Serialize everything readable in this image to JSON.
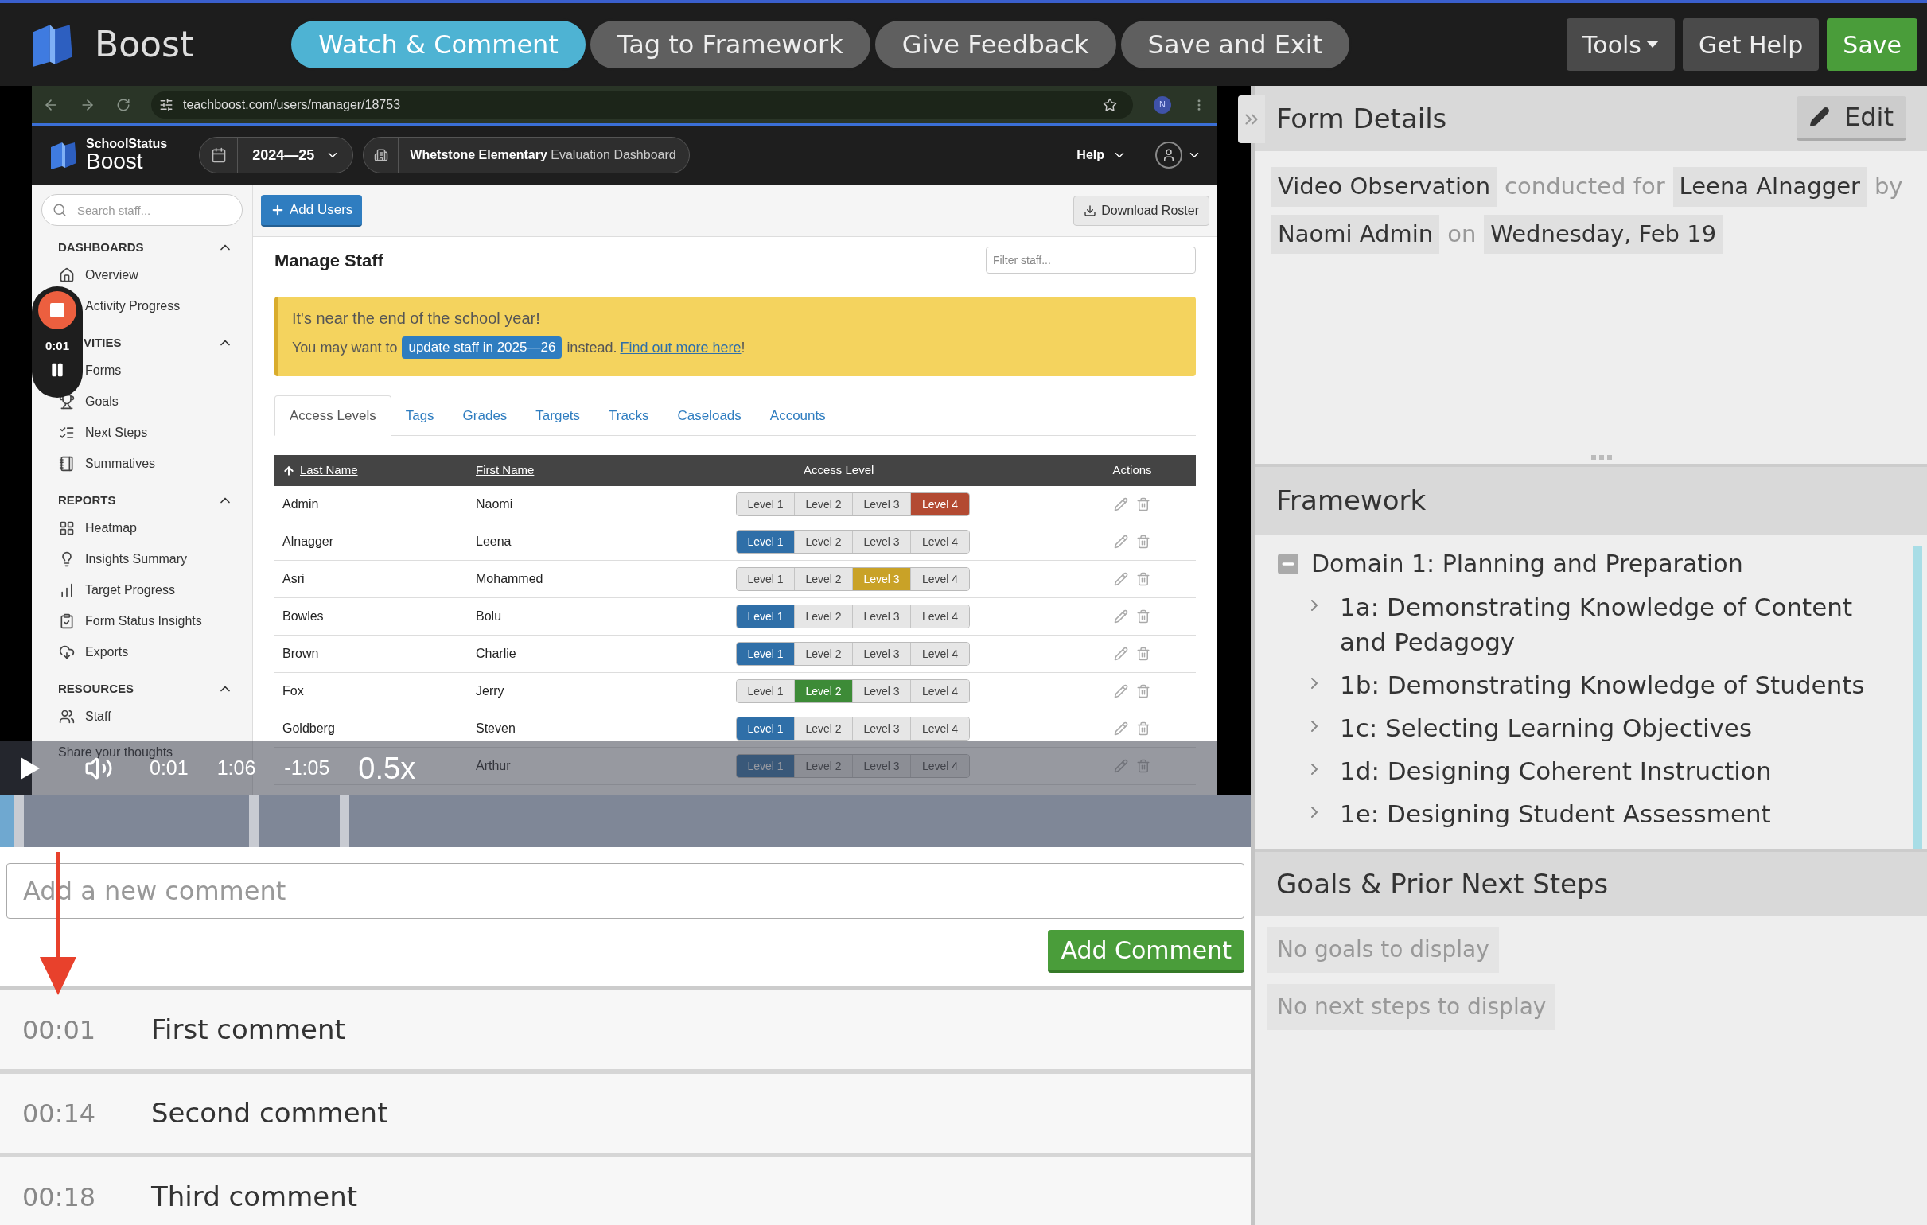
{
  "app_bar": {
    "logo_text": "Boost",
    "steps": [
      {
        "label": "Watch & Comment",
        "selected": true
      },
      {
        "label": "Tag to Framework",
        "selected": false
      },
      {
        "label": "Give Feedback",
        "selected": false
      },
      {
        "label": "Save and Exit",
        "selected": false
      }
    ],
    "buttons": [
      {
        "label": "Tools",
        "kind": "dropdown"
      },
      {
        "label": "Get Help",
        "kind": "plain"
      },
      {
        "label": "Save",
        "kind": "primary"
      }
    ]
  },
  "video": {
    "browser": {
      "url": "teachboost.com/users/manager/18753",
      "avatar": "N"
    },
    "app_header": {
      "brand_top": "SchoolStatus",
      "brand": "Boost",
      "year": "2024—25",
      "school": "Whetstone Elementary",
      "dashboard": "Evaluation Dashboard",
      "help": "Help"
    },
    "sidebar": {
      "search_placeholder": "Search staff...",
      "sections": [
        {
          "title": "DASHBOARDS",
          "expanded": true,
          "items": [
            "Overview",
            "Activity Progress"
          ]
        },
        {
          "title": "VITIES",
          "expanded": true,
          "items": [
            "Forms",
            "Goals",
            "Next Steps",
            "Summatives"
          ]
        },
        {
          "title": "REPORTS",
          "expanded": true,
          "items": [
            "Heatmap",
            "Insights Summary",
            "Target Progress",
            "Form Status Insights",
            "Exports"
          ]
        },
        {
          "title": "RESOURCES",
          "expanded": true,
          "items": [
            "Staff"
          ]
        }
      ],
      "footer": "Share your thoughts"
    },
    "toolbar": {
      "add_users": "Add Users",
      "download": "Download Roster"
    },
    "title": "Manage Staff",
    "filter_placeholder": "Filter staff...",
    "alert": {
      "heading": "It's near the end of the school year!",
      "before": "You may want to",
      "button": "update staff in 2025—26",
      "after": "instead.",
      "link": "Find out more here",
      "end": "!"
    },
    "tabs": [
      {
        "label": "Access Levels",
        "selected": true
      },
      {
        "label": "Tags",
        "selected": false
      },
      {
        "label": "Grades",
        "selected": false
      },
      {
        "label": "Targets",
        "selected": false
      },
      {
        "label": "Tracks",
        "selected": false
      },
      {
        "label": "Caseloads",
        "selected": false
      },
      {
        "label": "Accounts",
        "selected": false
      }
    ],
    "table": {
      "columns": [
        "Last Name",
        "First Name",
        "Access Level",
        "Actions"
      ],
      "rows": [
        {
          "last_name": "Admin",
          "first_name": "Naomi",
          "levels": [
            {
              "label": "Level 1",
              "selected": false
            },
            {
              "label": "Level 2",
              "selected": false
            },
            {
              "label": "Level 3",
              "selected": false
            },
            {
              "label": "Level 4",
              "selected": true
            }
          ]
        },
        {
          "last_name": "Alnagger",
          "first_name": "Leena",
          "levels": [
            {
              "label": "Level 1",
              "selected": true
            },
            {
              "label": "Level 2",
              "selected": false
            },
            {
              "label": "Level 3",
              "selected": false
            },
            {
              "label": "Level 4",
              "selected": false
            }
          ]
        },
        {
          "last_name": "Asri",
          "first_name": "Mohammed",
          "levels": [
            {
              "label": "Level 1",
              "selected": false
            },
            {
              "label": "Level 2",
              "selected": false
            },
            {
              "label": "Level 3",
              "selected": true
            },
            {
              "label": "Level 4",
              "selected": false
            }
          ]
        },
        {
          "last_name": "Bowles",
          "first_name": "Bolu",
          "levels": [
            {
              "label": "Level 1",
              "selected": true
            },
            {
              "label": "Level 2",
              "selected": false
            },
            {
              "label": "Level 3",
              "selected": false
            },
            {
              "label": "Level 4",
              "selected": false
            }
          ]
        },
        {
          "last_name": "Brown",
          "first_name": "Charlie",
          "levels": [
            {
              "label": "Level 1",
              "selected": true
            },
            {
              "label": "Level 2",
              "selected": false
            },
            {
              "label": "Level 3",
              "selected": false
            },
            {
              "label": "Level 4",
              "selected": false
            }
          ]
        },
        {
          "last_name": "Fox",
          "first_name": "Jerry",
          "levels": [
            {
              "label": "Level 1",
              "selected": false
            },
            {
              "label": "Level 2",
              "selected": true
            },
            {
              "label": "Level 3",
              "selected": false
            },
            {
              "label": "Level 4",
              "selected": false
            }
          ]
        },
        {
          "last_name": "Goldberg",
          "first_name": "Steven",
          "levels": [
            {
              "label": "Level 1",
              "selected": true
            },
            {
              "label": "Level 2",
              "selected": false
            },
            {
              "label": "Level 3",
              "selected": false
            },
            {
              "label": "Level 4",
              "selected": false
            }
          ]
        },
        {
          "first_name": "Arthur",
          "levels": [
            {
              "label": "Level 1",
              "selected": true
            },
            {
              "label": "Level 2",
              "selected": false
            },
            {
              "label": "Level 3",
              "selected": false
            },
            {
              "label": "Level 4",
              "selected": false
            }
          ]
        }
      ]
    },
    "recorder": {
      "time": "0:01"
    },
    "player": {
      "current": "0:01",
      "duration": "1:06",
      "remaining": "-1:05",
      "speed": "0.5x"
    }
  },
  "comment_box": {
    "placeholder": "Add a new comment",
    "button": "Add Comment"
  },
  "comments": [
    {
      "time": "00:01",
      "text": "First comment"
    },
    {
      "time": "00:14",
      "text": "Second comment"
    },
    {
      "time": "00:18",
      "text": "Third comment"
    }
  ],
  "form_details": {
    "title": "Form Details",
    "edit": "Edit",
    "sentence": [
      {
        "text": "Video Observation",
        "kind": "value"
      },
      {
        "text": "conducted for",
        "kind": "word"
      },
      {
        "text": "Leena Alnagger",
        "kind": "value"
      },
      {
        "text": "by",
        "kind": "word"
      },
      {
        "text": "Naomi Admin",
        "kind": "value"
      },
      {
        "text": "on",
        "kind": "word"
      },
      {
        "text": "Wednesday, Feb 19",
        "kind": "value"
      }
    ]
  },
  "framework": {
    "title": "Framework",
    "domains": [
      {
        "label": "Domain 1: Planning and Preparation",
        "expanded": true,
        "children": [
          {
            "label": "1a: Demonstrating Knowledge of Content and Pedagogy",
            "expanded": false
          },
          {
            "label": "1b: Demonstrating Knowledge of Students",
            "expanded": false
          },
          {
            "label": "1c: Selecting Learning Objectives",
            "expanded": false
          },
          {
            "label": "1d: Designing Coherent Instruction",
            "expanded": false
          },
          {
            "label": "1e: Designing Student Assessment",
            "expanded": false
          }
        ]
      }
    ]
  },
  "goals": {
    "title": "Goals & Prior Next Steps",
    "empty": [
      "No goals to display",
      "No next steps to display"
    ]
  }
}
